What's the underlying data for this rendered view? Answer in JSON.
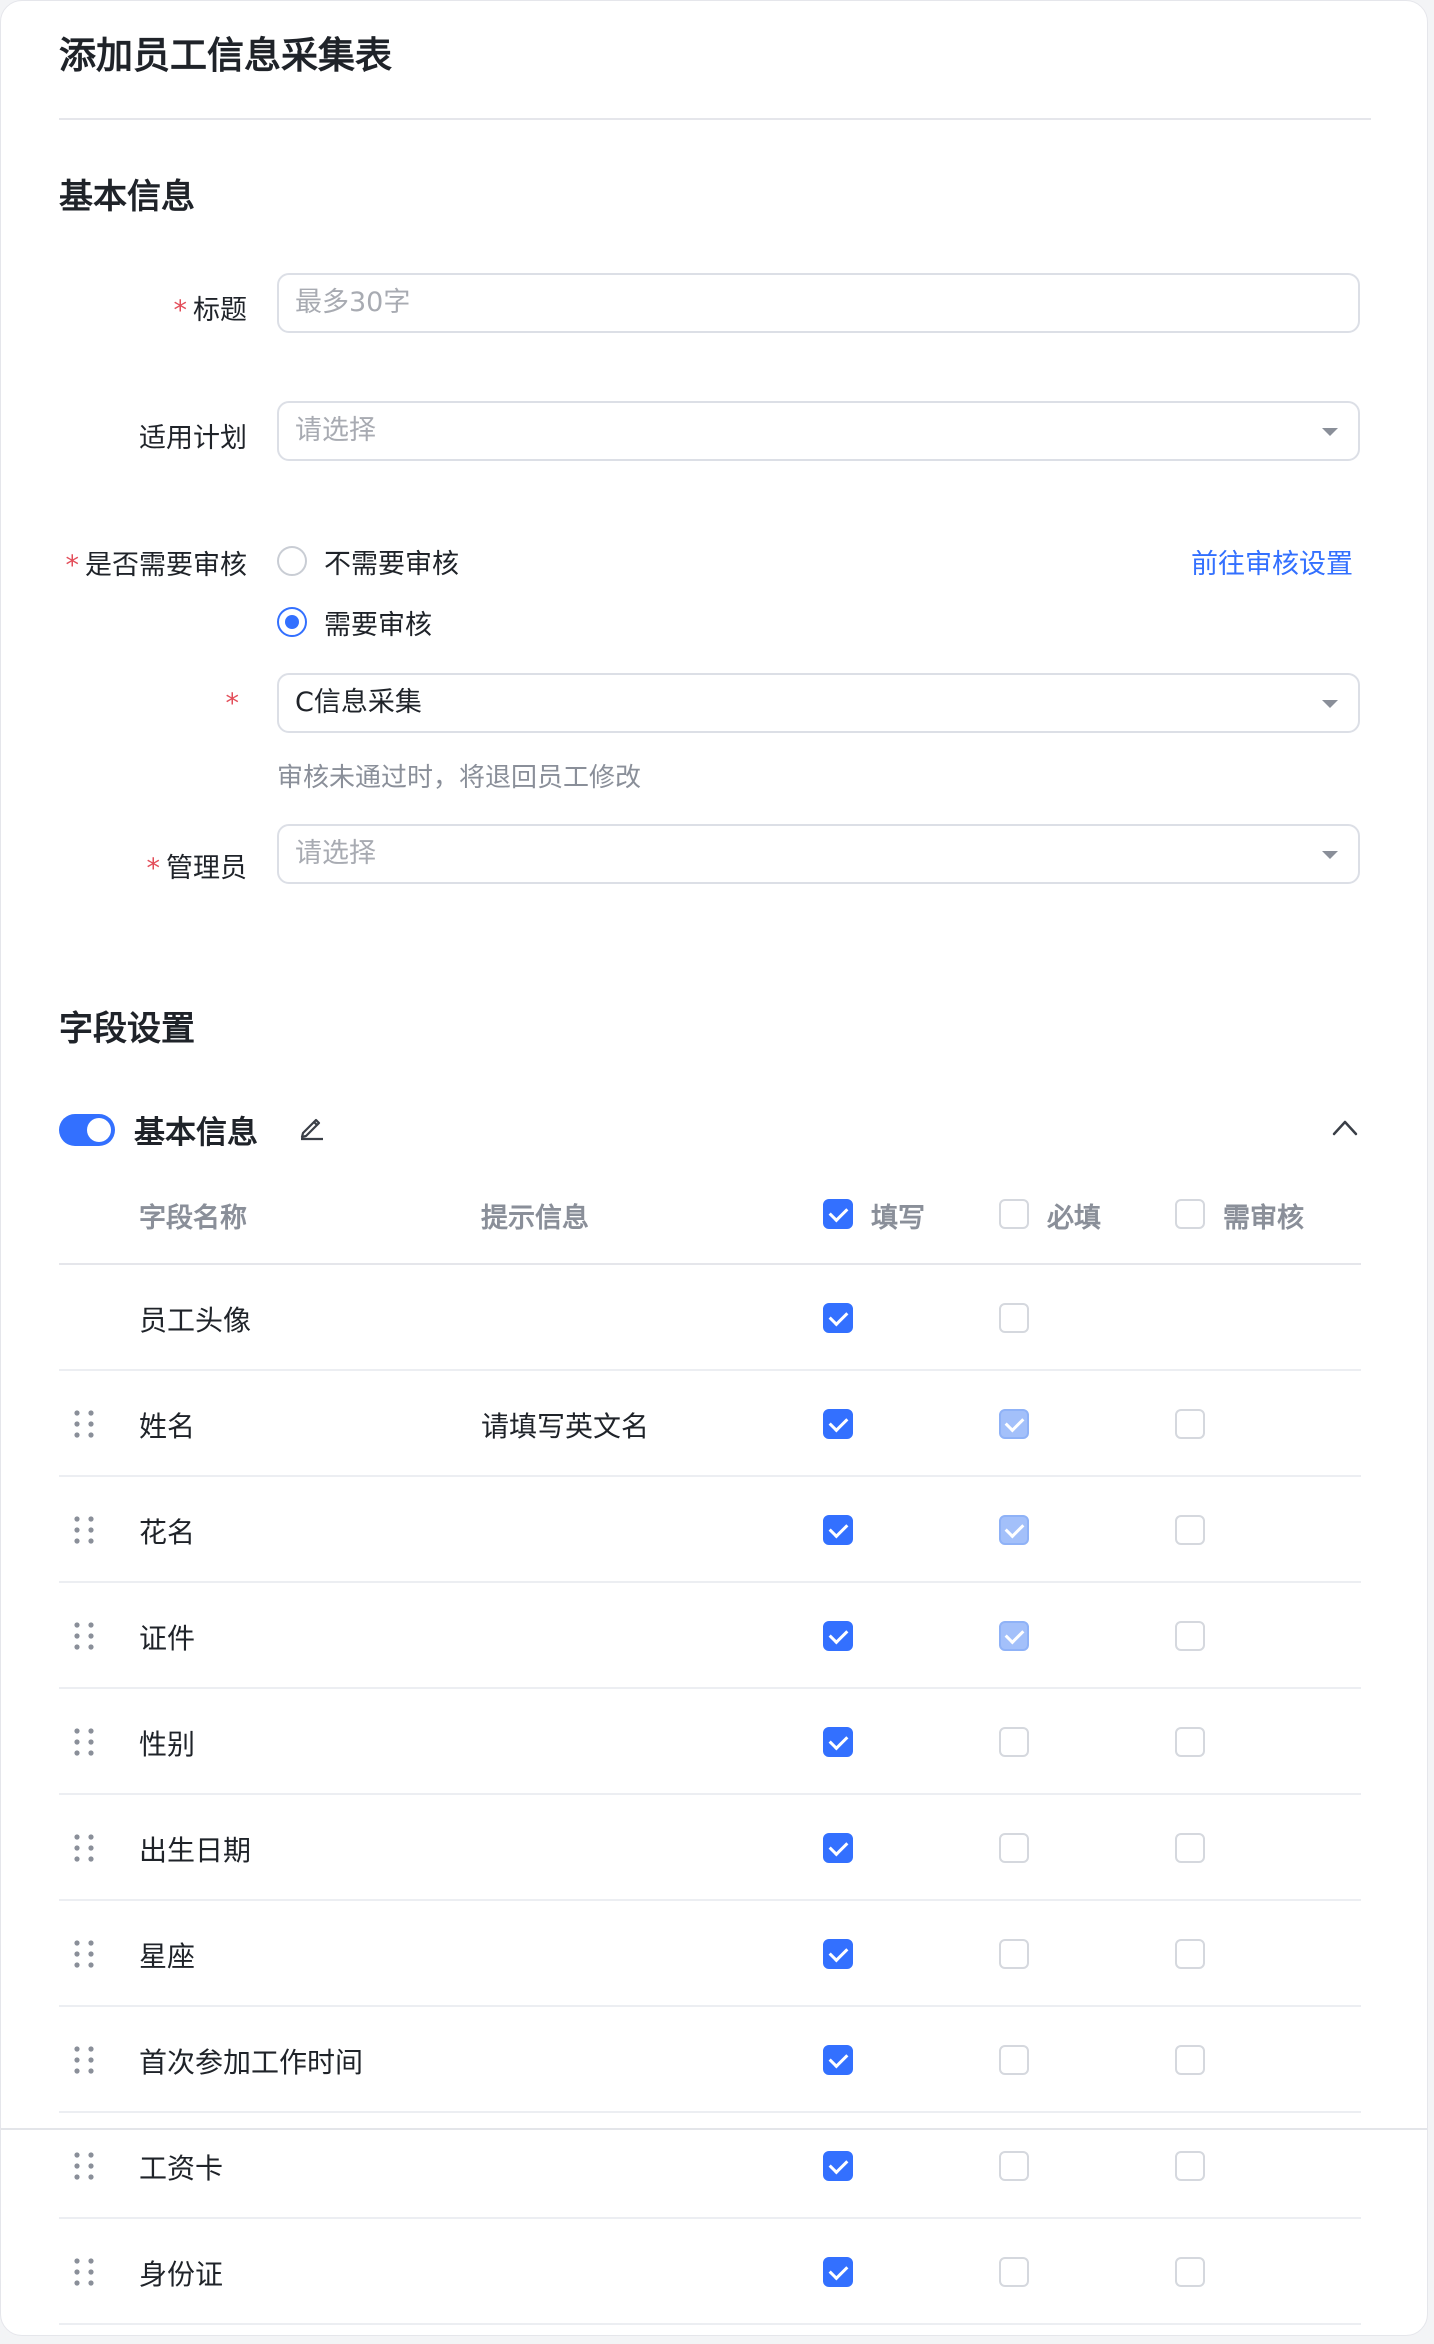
{
  "page": {
    "title": "添加员工信息采集表"
  },
  "basic_section": {
    "title": "基本信息"
  },
  "form": {
    "title_label": "标题",
    "title_placeholder": "最多30字",
    "plan_label": "适用计划",
    "plan_placeholder": "请选择",
    "review_label": "是否需要审核",
    "review_options": [
      "不需要审核",
      "需要审核"
    ],
    "review_selected": "需要审核",
    "review_link": "前往审核设置",
    "review_flow_value": "C信息采集",
    "review_hint": "审核未通过时，将退回员工修改",
    "admin_label": "管理员",
    "admin_placeholder": "请选择",
    "required_mark": "*"
  },
  "fields_section": {
    "title": "字段设置",
    "group": {
      "title": "基本信息",
      "enabled": true,
      "expanded": true
    },
    "headers": {
      "name": "字段名称",
      "tip": "提示信息",
      "fill": "填写",
      "required": "必填",
      "review": "需审核"
    },
    "header_checks": {
      "fill": true,
      "required": false,
      "review": false
    },
    "rows": [
      {
        "name": "员工头像",
        "tip": "",
        "fill": "on",
        "required": "off",
        "review": null,
        "draggable": false
      },
      {
        "name": "姓名",
        "tip": "请填写英文名",
        "fill": "on",
        "required": "disabled-on",
        "review": "off",
        "draggable": true
      },
      {
        "name": "花名",
        "tip": "",
        "fill": "on",
        "required": "disabled-on",
        "review": "off",
        "draggable": true
      },
      {
        "name": "证件",
        "tip": "",
        "fill": "on",
        "required": "disabled-on",
        "review": "off",
        "draggable": true
      },
      {
        "name": "性别",
        "tip": "",
        "fill": "on",
        "required": "off",
        "review": "off",
        "draggable": true
      },
      {
        "name": "出生日期",
        "tip": "",
        "fill": "on",
        "required": "off",
        "review": "off",
        "draggable": true
      },
      {
        "name": "星座",
        "tip": "",
        "fill": "on",
        "required": "off",
        "review": "off",
        "draggable": true
      },
      {
        "name": "首次参加工作时间",
        "tip": "",
        "fill": "on",
        "required": "off",
        "review": "off",
        "draggable": true
      },
      {
        "name": "工资卡",
        "tip": "",
        "fill": "on",
        "required": "off",
        "review": "off",
        "draggable": true
      },
      {
        "name": "身份证",
        "tip": "",
        "fill": "on",
        "required": "off",
        "review": "off",
        "draggable": true
      }
    ]
  },
  "colors": {
    "primary": "#3370ff",
    "required_star": "#e34d59",
    "muted_text": "#8a8f99"
  },
  "icons": {
    "edit": "pencil-icon",
    "collapse": "chevron-up-icon",
    "drag": "drag-handle-icon",
    "select": "caret-down-icon"
  }
}
